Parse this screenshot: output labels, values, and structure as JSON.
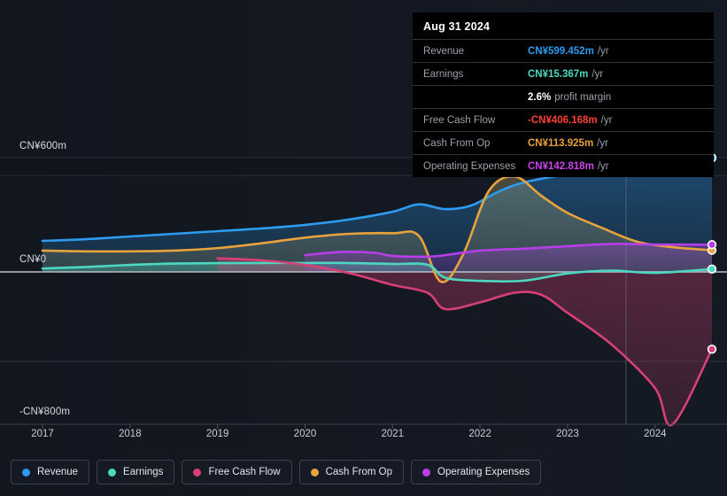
{
  "tooltip": {
    "date": "Aug 31 2024",
    "rows": [
      {
        "label": "Revenue",
        "value": "CN¥599.452m",
        "unit": "/yr",
        "color": "#2e9bef"
      },
      {
        "label": "Earnings",
        "value": "CN¥15.367m",
        "unit": "/yr",
        "color": "#4cd8c0"
      },
      {
        "label": "",
        "value": "2.6%",
        "unit": "profit margin",
        "color": "#ffffff"
      },
      {
        "label": "Free Cash Flow",
        "value": "-CN¥406.168m",
        "unit": "/yr",
        "color": "#ff4136"
      },
      {
        "label": "Cash From Op",
        "value": "CN¥113.925m",
        "unit": "/yr",
        "color": "#e9a33c"
      },
      {
        "label": "Operating Expenses",
        "value": "CN¥142.818m",
        "unit": "/yr",
        "color": "#cc45ee"
      }
    ]
  },
  "legend": {
    "items": [
      {
        "label": "Revenue",
        "color": "#2e9bef"
      },
      {
        "label": "Earnings",
        "color": "#4cd8c0"
      },
      {
        "label": "Free Cash Flow",
        "color": "#d83f76"
      },
      {
        "label": "Cash From Op",
        "color": "#e9a33c"
      },
      {
        "label": "Operating Expenses",
        "color": "#b63fe8"
      }
    ]
  },
  "axes": {
    "y_labels": {
      "top": "CN¥600m",
      "zero": "CN¥0",
      "bottom": "-CN¥800m"
    },
    "x_labels": [
      "2017",
      "2018",
      "2019",
      "2020",
      "2021",
      "2022",
      "2023",
      "2024"
    ]
  },
  "chart_data": {
    "type": "area",
    "title": "",
    "xlabel": "",
    "ylabel": "CN¥",
    "ylim": [
      -800,
      600
    ],
    "yticks": [
      600,
      0,
      -800
    ],
    "ytick_labels": [
      "CN¥600m",
      "CN¥0",
      "-CN¥800m"
    ],
    "x": [
      "2017",
      "2018",
      "2019",
      "2020",
      "2021",
      "2022",
      "2023",
      "2024"
    ],
    "xlim": [
      "2017",
      "2024.7"
    ],
    "grid": true,
    "legend_position": "bottom-left",
    "highlight_x": "Aug 31 2024",
    "series": [
      {
        "name": "Revenue",
        "color": "#2e9bef",
        "x": [
          2017,
          2017.5,
          2018,
          2018.5,
          2019,
          2019.5,
          2020,
          2020.5,
          2021,
          2021.3,
          2021.6,
          2021.9,
          2022.2,
          2022.5,
          2023,
          2023.5,
          2024,
          2024.65
        ],
        "values": [
          163,
          172,
          186,
          200,
          214,
          228,
          247,
          275,
          316,
          355,
          330,
          349,
          419,
          470,
          512,
          535,
          555,
          599
        ]
      },
      {
        "name": "Earnings",
        "color": "#4cd8c0",
        "x": [
          2017,
          2017.5,
          2018,
          2018.5,
          2019,
          2019.5,
          2020,
          2020.5,
          2021,
          2021.4,
          2021.6,
          2022,
          2022.5,
          2023,
          2023.5,
          2024,
          2024.65
        ],
        "values": [
          18,
          26,
          37,
          44,
          46,
          47,
          47,
          47,
          42,
          38,
          -30,
          -47,
          -46,
          -8,
          7,
          -5,
          15
        ]
      },
      {
        "name": "Free Cash Flow",
        "color": "#d83f76",
        "x": [
          2019,
          2019.5,
          2020,
          2020.5,
          2021,
          2021.4,
          2021.6,
          2022,
          2022.4,
          2022.7,
          2023,
          2023.5,
          2024,
          2024.2,
          2024.65
        ],
        "values": [
          72,
          61,
          37,
          -6,
          -68,
          -110,
          -195,
          -160,
          -109,
          -120,
          -215,
          -380,
          -610,
          -800,
          -406
        ]
      },
      {
        "name": "Cash From Op",
        "color": "#e9a33c",
        "x": [
          2017,
          2017.5,
          2018,
          2018.5,
          2019,
          2019.5,
          2020,
          2020.5,
          2021,
          2021.3,
          2021.55,
          2021.8,
          2022.1,
          2022.4,
          2022.7,
          2023,
          2023.4,
          2023.8,
          2024.2,
          2024.65
        ],
        "values": [
          112,
          108,
          108,
          112,
          125,
          150,
          180,
          200,
          203,
          190,
          -51,
          85,
          425,
          500,
          400,
          310,
          230,
          158,
          130,
          114
        ]
      },
      {
        "name": "Operating Expenses",
        "color": "#b63fe8",
        "x": [
          2020,
          2020.4,
          2020.8,
          2021,
          2021.4,
          2021.6,
          2022,
          2022.5,
          2023,
          2023.5,
          2024,
          2024.65
        ],
        "values": [
          88,
          105,
          100,
          84,
          80,
          88,
          112,
          122,
          135,
          147,
          144,
          143
        ]
      }
    ]
  }
}
